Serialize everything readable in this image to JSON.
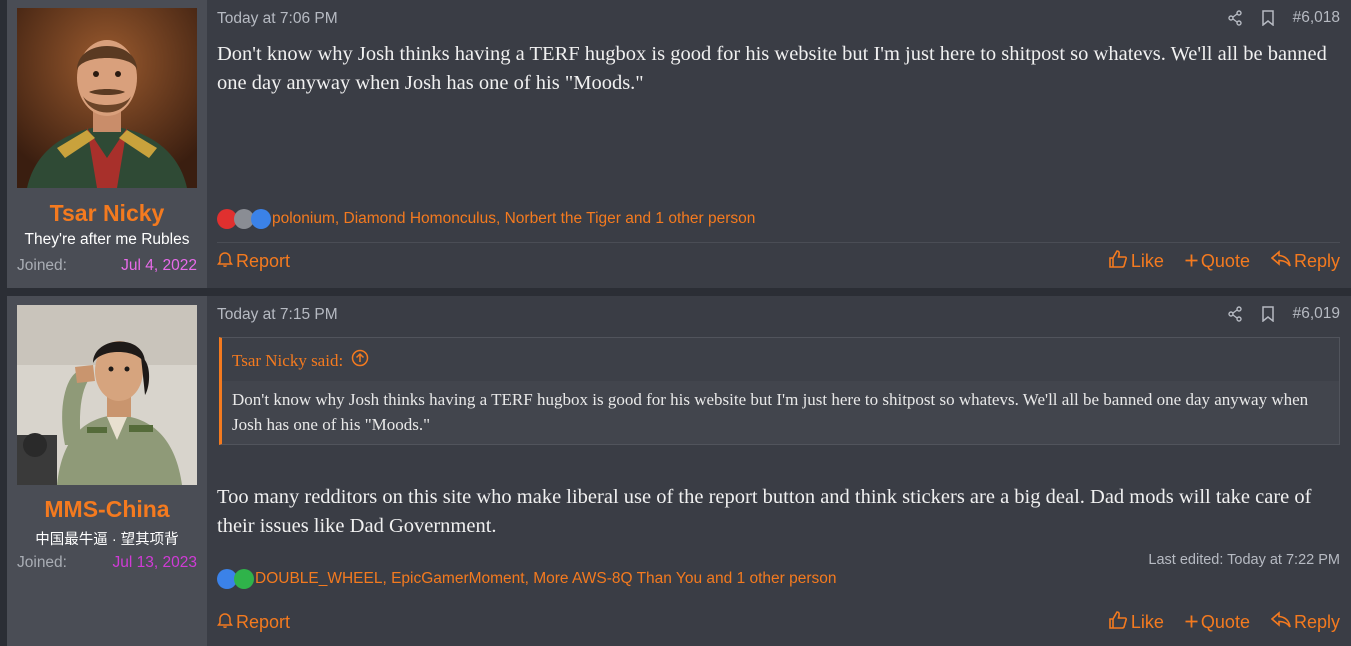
{
  "posts": [
    {
      "username": "Tsar Nicky",
      "user_title": "They're after me Rubles",
      "joined_label": "Joined:",
      "joined_date": "Jul 4, 2022",
      "date": "Today at 7:06 PM",
      "post_number": "#6,018",
      "body": "Don't know why Josh thinks having a TERF hugbox is good for his website but I'm just here to shitpost so whatevs. We'll all be banned one day anyway when Josh has one of his \"Moods.\"",
      "reaction_icons": [
        "heart-icon",
        "pipe-icon",
        "thumbs-up-icon"
      ],
      "reactions": "polonium, Diamond Homonculus, Norbert the Tiger and 1 other person",
      "report_label": "Report",
      "like_label": "Like",
      "quote_label": "Quote",
      "reply_label": "Reply"
    },
    {
      "username": "MMS-China",
      "user_title": "中国最牛逼 · 望其项背",
      "joined_label": "Joined:",
      "joined_date": "Jul 13, 2023",
      "date": "Today at 7:15 PM",
      "post_number": "#6,019",
      "quote_author": "Tsar Nicky said:",
      "quote_body": "Don't know why Josh thinks having a TERF hugbox is good for his website but I'm just here to shitpost so whatevs. We'll all be banned one day anyway when Josh has one of his \"Moods.\"",
      "body": "Too many redditors on this site who make liberal use of the report button and think stickers are a big deal. Dad mods will take care of their issues like Dad Government.",
      "edited": "Last edited: Today at 7:22 PM",
      "reaction_icons": [
        "thumbs-up-icon",
        "check-icon"
      ],
      "reactions": "DOUBLE_WHEEL, EpicGamerMoment, More AWS-8Q Than You and 1 other person",
      "report_label": "Report",
      "like_label": "Like",
      "quote_label": "Quote",
      "reply_label": "Reply"
    }
  ],
  "colors": {
    "accent": "#f47a1f",
    "joined_date_1": "#e86bea",
    "joined_date_2": "#d03bd6",
    "post_bg": "#3a3d45",
    "user_bg": "#4a4d55"
  }
}
